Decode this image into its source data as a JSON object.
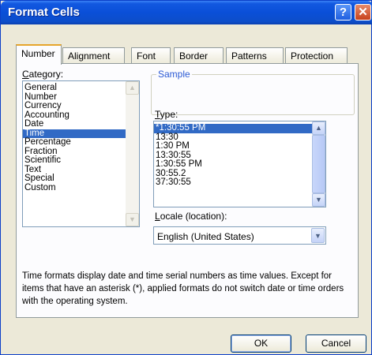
{
  "dialog": {
    "title": "Format Cells",
    "help_glyph": "?",
    "close_glyph": "✕"
  },
  "tabs": [
    "Number",
    "Alignment",
    "Font",
    "Border",
    "Patterns",
    "Protection"
  ],
  "active_tab": "Number",
  "category": {
    "label_first": "C",
    "label_rest": "ategory:",
    "items": [
      "General",
      "Number",
      "Currency",
      "Accounting",
      "Date",
      "Time",
      "Percentage",
      "Fraction",
      "Scientific",
      "Text",
      "Special",
      "Custom"
    ],
    "selected": "Time"
  },
  "sample": {
    "label": "Sample",
    "value": ""
  },
  "type": {
    "label_first": "T",
    "label_rest": "ype:",
    "items": [
      "*1:30:55 PM",
      "13:30",
      "1:30 PM",
      "13:30:55",
      "1:30:55 PM",
      "30:55.2",
      "37:30:55"
    ],
    "selected": "*1:30:55 PM"
  },
  "locale": {
    "label_first": "L",
    "label_rest": "ocale (location):",
    "value": "English (United States)"
  },
  "description": "Time formats display date and time serial numbers as time values. Except for items that have an asterisk (*), applied formats do not switch date or time orders with the operating system.",
  "buttons": {
    "ok": "OK",
    "cancel": "Cancel"
  },
  "glyphs": {
    "up": "▲",
    "down": "▼"
  }
}
